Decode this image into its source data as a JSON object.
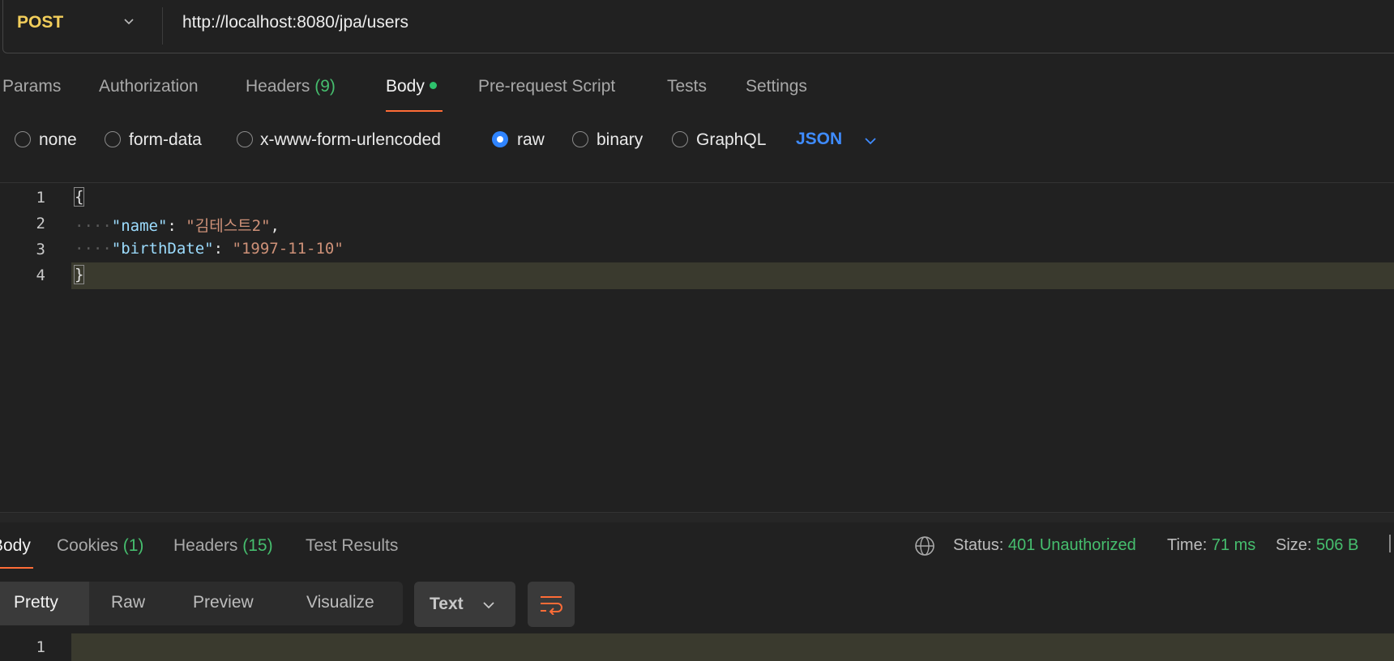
{
  "request": {
    "method": "POST",
    "url": "http://localhost:8080/jpa/users"
  },
  "request_tabs": {
    "params": "Params",
    "authorization": "Authorization",
    "headers_label": "Headers",
    "headers_count": "(9)",
    "body": "Body",
    "prerequest": "Pre-request Script",
    "tests": "Tests",
    "settings": "Settings"
  },
  "body_types": {
    "none": "none",
    "form_data": "form-data",
    "urlencoded": "x-www-form-urlencoded",
    "raw": "raw",
    "binary": "binary",
    "graphql": "GraphQL",
    "selected": "raw",
    "format": "JSON"
  },
  "editor": {
    "line_numbers": [
      "1",
      "2",
      "3",
      "4"
    ],
    "open_brace": "{",
    "close_brace": "}",
    "indent": "····",
    "key1": "\"name\"",
    "val1": "\"김테스트2\"",
    "key2": "\"birthDate\"",
    "val2": "\"1997-11-10\"",
    "colon": ": ",
    "comma": ","
  },
  "response": {
    "tabs": {
      "body": "Body",
      "cookies_label": "Cookies",
      "cookies_count": "(1)",
      "headers_label": "Headers",
      "headers_count": "(15)",
      "test_results": "Test Results"
    },
    "status_label": "Status:",
    "status_value": "401 Unauthorized",
    "time_label": "Time:",
    "time_value": "71 ms",
    "size_label": "Size:",
    "size_value": "506 B",
    "view_modes": [
      "Pretty",
      "Raw",
      "Preview",
      "Visualize"
    ],
    "format": "Text",
    "line_numbers": [
      "1"
    ]
  },
  "colors": {
    "accent": "#ff6c37",
    "method": "#f2ce5b",
    "success_green": "#46be6e",
    "link_blue": "#3f8cff"
  }
}
